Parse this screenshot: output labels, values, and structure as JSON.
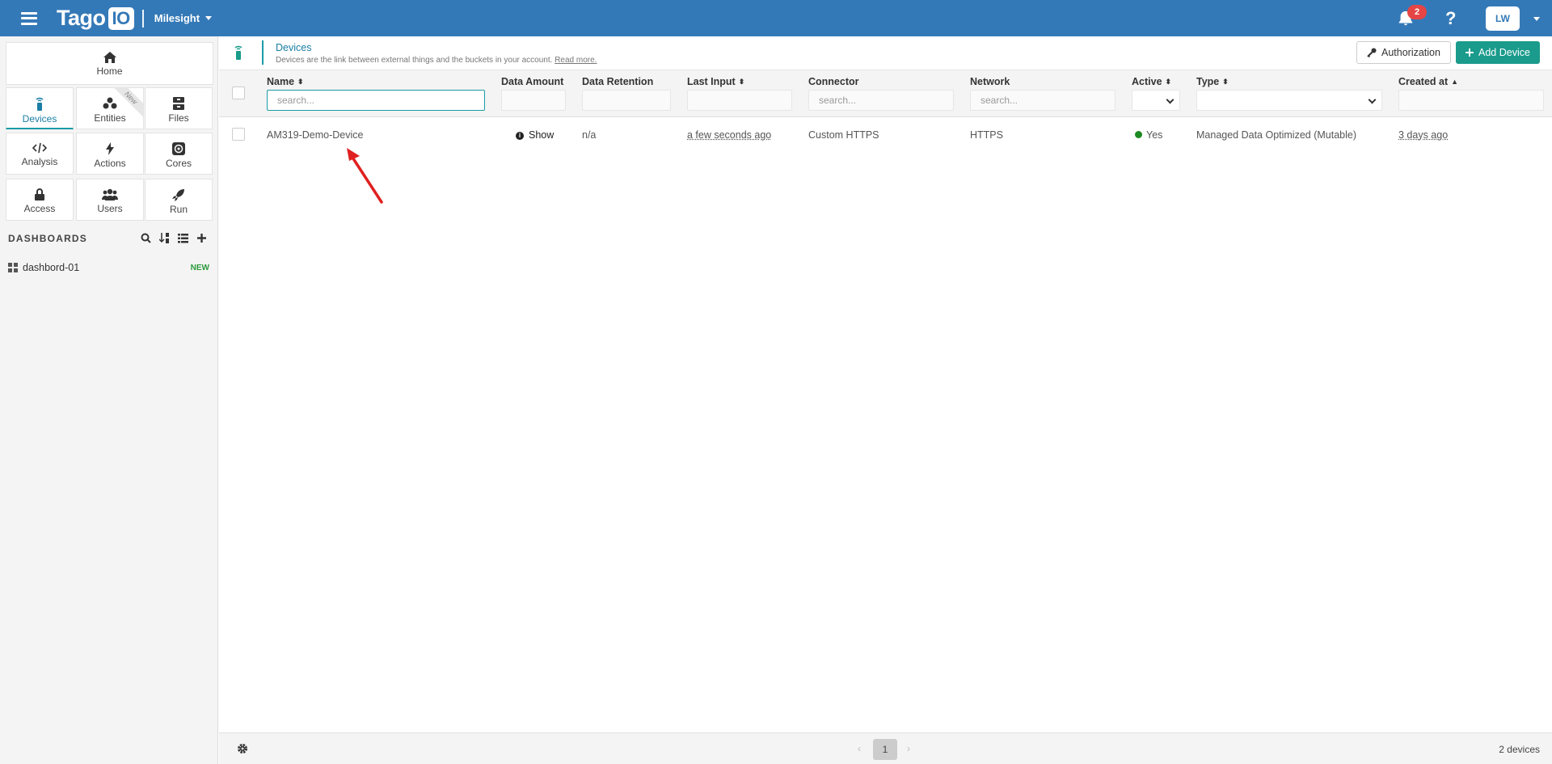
{
  "topbar": {
    "logo_text": "Tago",
    "logo_box": "IO",
    "profile_name": "Milesight",
    "notifications_count": "2",
    "help_label": "?",
    "avatar_initials": "LW"
  },
  "sidebar": {
    "home_label": "Home",
    "tiles": [
      {
        "label": "Devices",
        "icon": "device-icon"
      },
      {
        "label": "Entities",
        "icon": "entities-icon",
        "ribbon": "New"
      },
      {
        "label": "Files",
        "icon": "files-icon"
      },
      {
        "label": "Analysis",
        "icon": "code-icon"
      },
      {
        "label": "Actions",
        "icon": "bolt-icon"
      },
      {
        "label": "Cores",
        "icon": "cores-icon"
      },
      {
        "label": "Access",
        "icon": "lock-icon"
      },
      {
        "label": "Users",
        "icon": "users-icon"
      },
      {
        "label": "Run",
        "icon": "rocket-icon"
      }
    ],
    "dashboards_title": "DASHBOARDS",
    "dashboards": [
      {
        "name": "dashbord-01",
        "tag": "NEW"
      }
    ]
  },
  "header": {
    "title": "Devices",
    "description": "Devices are the link between external things and the buckets in your account.",
    "read_more": "Read more.",
    "authorization_label": "Authorization",
    "add_device_label": "Add Device"
  },
  "table": {
    "columns": {
      "name": "Name",
      "data_amount": "Data Amount",
      "data_retention": "Data Retention",
      "last_input": "Last Input",
      "connector": "Connector",
      "network": "Network",
      "active": "Active",
      "type": "Type",
      "created_at": "Created at"
    },
    "filters": {
      "name_placeholder": "search...",
      "connector_placeholder": "search...",
      "network_placeholder": "search..."
    },
    "rows": [
      {
        "name": "AM319-Demo-Device",
        "data_amount": "Show",
        "data_retention": "n/a",
        "last_input": "a few seconds ago",
        "connector": "Custom HTTPS",
        "network": "HTTPS",
        "active": "Yes",
        "type": "Managed Data Optimized (Mutable)",
        "created_at": "3 days ago"
      }
    ]
  },
  "footer": {
    "current_page": "1",
    "count_text": "2 devices"
  },
  "colors": {
    "topbar": "#3479b7",
    "accent_teal": "#1a9b8c",
    "active_green": "#1d8a20",
    "badge_red": "#e64545",
    "annotation_arrow": "#e02020"
  }
}
